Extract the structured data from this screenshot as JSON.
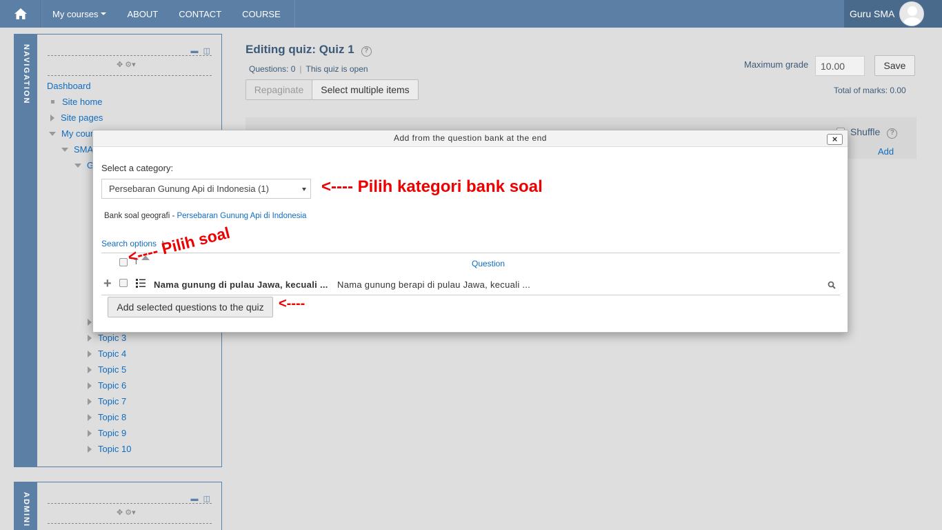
{
  "navbar": {
    "items": [
      "My courses",
      "ABOUT",
      "CONTACT",
      "COURSE"
    ],
    "user_name": "Guru SMA"
  },
  "nav_block": {
    "title": "NAVIGATION",
    "items": {
      "dashboard": "Dashboard",
      "site_home": "Site home",
      "site_pages": "Site pages",
      "my_courses": "My cour",
      "sma": "SMA",
      "g": "G"
    },
    "topics": [
      "Topic 3",
      "Topic 4",
      "Topic 5",
      "Topic 6",
      "Topic 7",
      "Topic 8",
      "Topic 9",
      "Topic 10"
    ]
  },
  "admin_block": {
    "title": "ADMINI"
  },
  "quiz": {
    "title": "Editing quiz: Quiz 1",
    "questions_info": "Questions: 0",
    "status": "This quiz is open",
    "repaginate": "Repaginate",
    "select_multiple": "Select multiple items",
    "max_grade_label": "Maximum grade",
    "max_grade_value": "10.00",
    "save": "Save",
    "total_marks": "Total of marks: 0.00",
    "shuffle": "Shuffle",
    "add": "Add"
  },
  "dialog": {
    "title": "Add from the question bank at the end",
    "close": "×",
    "category_label": "Select a category:",
    "category_value": "Persebaran Gunung Api di Indonesia (1)",
    "bank_prefix": "Bank soal geografi - ",
    "bank_link": "Persebaran Gunung Api di Indonesia",
    "search_options": "Search options",
    "sort_label": "T",
    "col_question": "Question",
    "question_name": "Nama gunung di pulau Jawa, kecuali ...",
    "question_text": "Nama gunung berapi di pulau Jawa, kecuali ...",
    "add_selected": "Add selected questions to the quiz"
  },
  "annotations": {
    "category": "<---- Pilih kategori bank soal",
    "question": "<---- Pilih soal",
    "button": "<----"
  },
  "colors": {
    "navbar": "#5c7fa5",
    "link": "#0f6cbf",
    "annotation": "#e00000"
  }
}
